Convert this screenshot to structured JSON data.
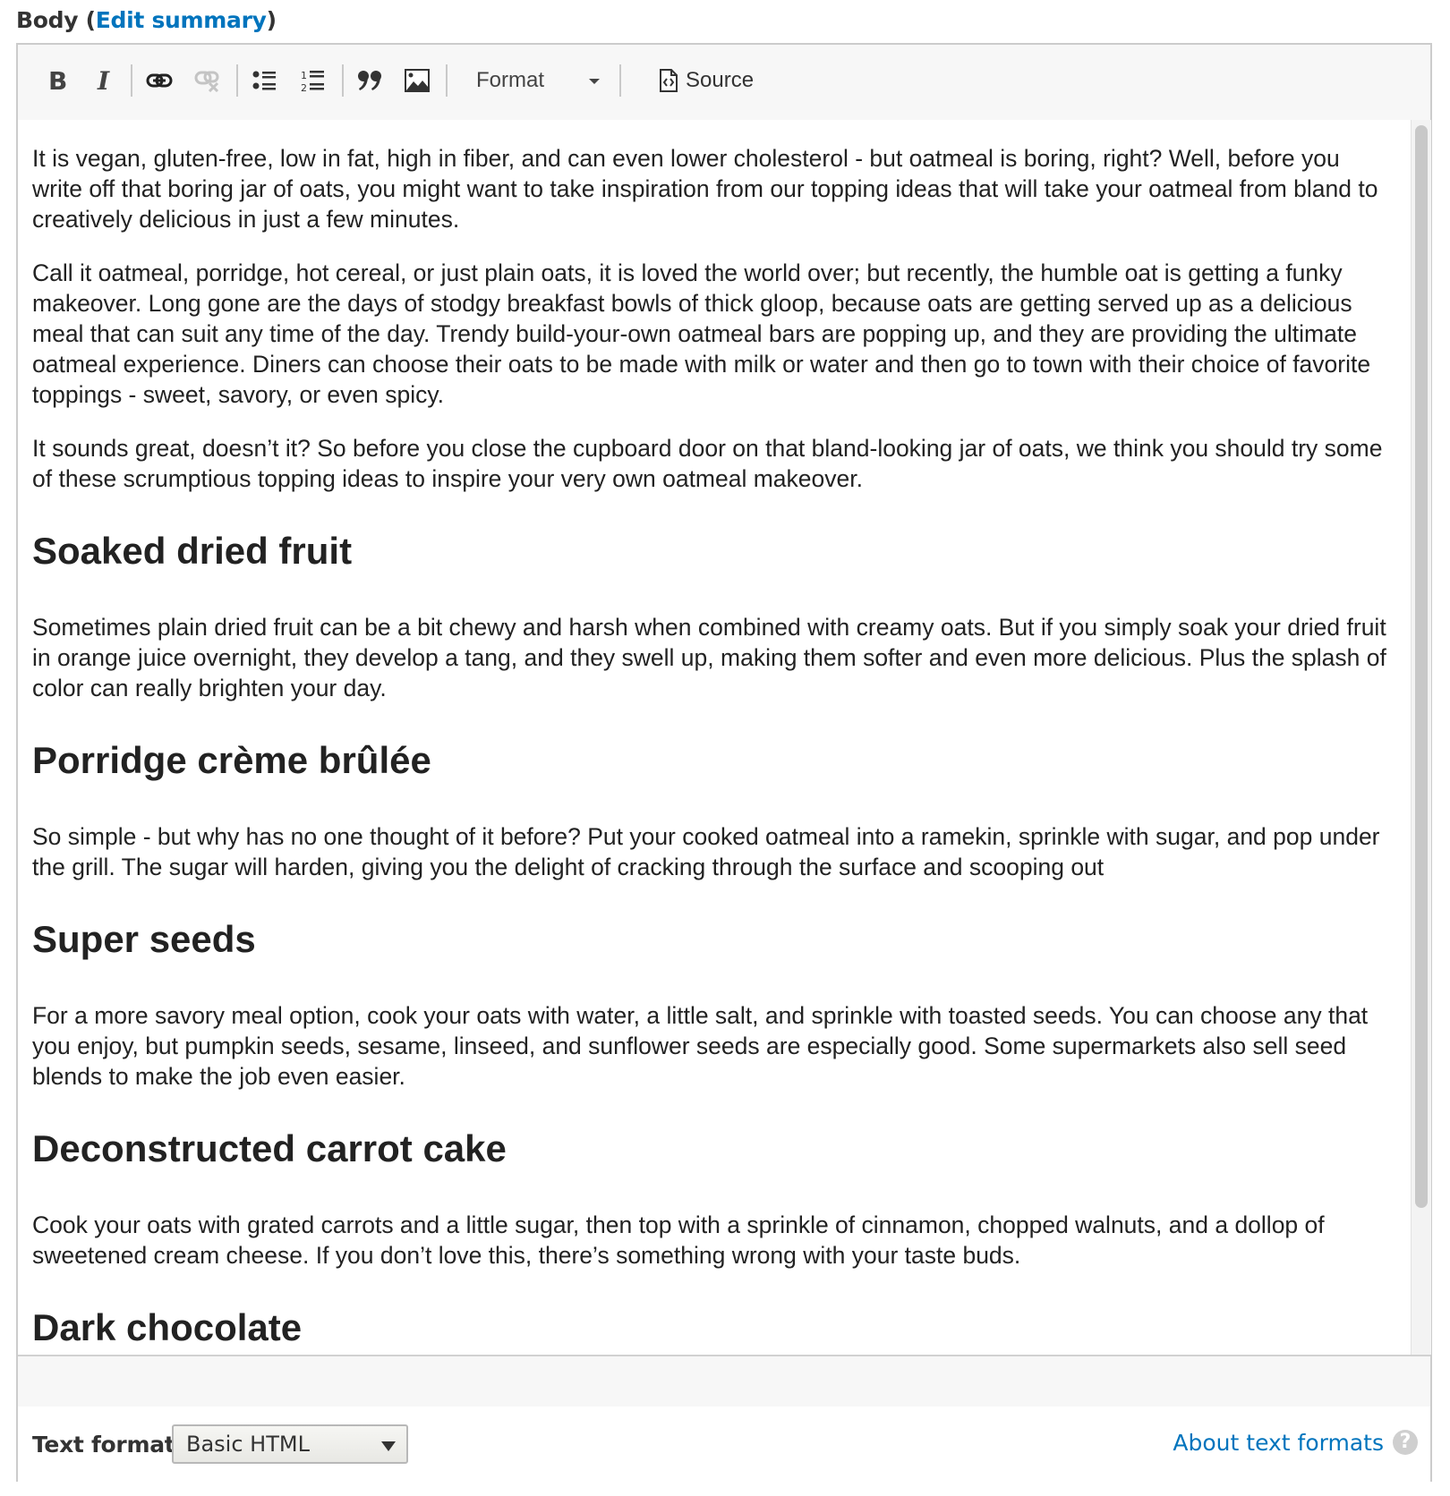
{
  "field": {
    "label": "Body",
    "open_paren": " (",
    "edit_summary_link": "Edit summary",
    "close_paren": ")"
  },
  "toolbar": {
    "buttons": [
      {
        "name": "bold",
        "icon": "bold-icon"
      },
      {
        "name": "italic",
        "icon": "italic-icon"
      },
      {
        "name": "link",
        "icon": "link-icon"
      },
      {
        "name": "unlink",
        "icon": "unlink-icon",
        "disabled": true
      },
      {
        "name": "bulleted-list",
        "icon": "bulleted-list-icon"
      },
      {
        "name": "numbered-list",
        "icon": "numbered-list-icon"
      },
      {
        "name": "blockquote",
        "icon": "blockquote-icon"
      },
      {
        "name": "image",
        "icon": "image-icon"
      }
    ],
    "format_label": "Format",
    "source_label": "Source"
  },
  "content": {
    "paragraphs_intro": [
      "It is vegan, gluten-free, low in fat, high in fiber, and can even lower cholesterol - but oatmeal is boring, right? Well, before you write off that boring jar of oats, you might want to take inspiration from our topping ideas that will take your oatmeal from bland to creatively delicious in just a few minutes.",
      "Call it oatmeal, porridge, hot cereal, or just plain oats, it is loved the world over; but recently, the humble oat is getting a funky makeover. Long gone are the days of stodgy breakfast bowls of thick gloop, because oats are getting served up as a delicious meal that can suit any time of the day. Trendy build-your-own oatmeal bars are popping up, and they are providing the ultimate oatmeal experience. Diners can choose their oats to be made with milk or water and then go to town with their choice of favorite toppings - sweet, savory, or even spicy.",
      "It sounds great, doesn’t it? So before you close the cupboard door on that bland-looking jar of oats, we think you should try some of these scrumptious topping ideas to inspire your very own oatmeal makeover."
    ],
    "sections": [
      {
        "heading": "Soaked dried fruit",
        "body": "Sometimes plain dried fruit can be a bit chewy and harsh when combined with creamy oats. But if you simply soak your dried fruit in orange juice overnight, they develop a tang, and they swell up, making them softer and even more delicious. Plus the splash of color can really brighten your day."
      },
      {
        "heading": "Porridge crème brûlée",
        "body": "So simple - but why has no one thought of it before? Put your cooked oatmeal into a ramekin, sprinkle with sugar, and pop under the grill. The sugar will harden, giving you the delight of cracking through the surface and scooping out"
      },
      {
        "heading": "Super seeds",
        "body": "For a more savory meal option, cook your oats with water, a little salt, and sprinkle with toasted seeds. You can choose any that you enjoy, but pumpkin seeds, sesame, linseed, and sunflower seeds are especially good. Some supermarkets also sell seed blends to make the job even easier."
      },
      {
        "heading": "Deconstructed carrot cake",
        "body": "Cook your oats with grated carrots and a little sugar, then top with a sprinkle of cinnamon, chopped walnuts, and a dollop of sweetened cream cheese. If you don’t love this, there’s something wrong with your taste buds."
      },
      {
        "heading": "Dark chocolate",
        "body": ""
      }
    ]
  },
  "text_format": {
    "label": "Text format",
    "selected": "Basic HTML",
    "about_link": "About text formats",
    "help_icon": "?"
  },
  "colors": {
    "link": "#0074bd",
    "toolbar_bg": "#f7f7f7",
    "border": "#cccccc"
  }
}
